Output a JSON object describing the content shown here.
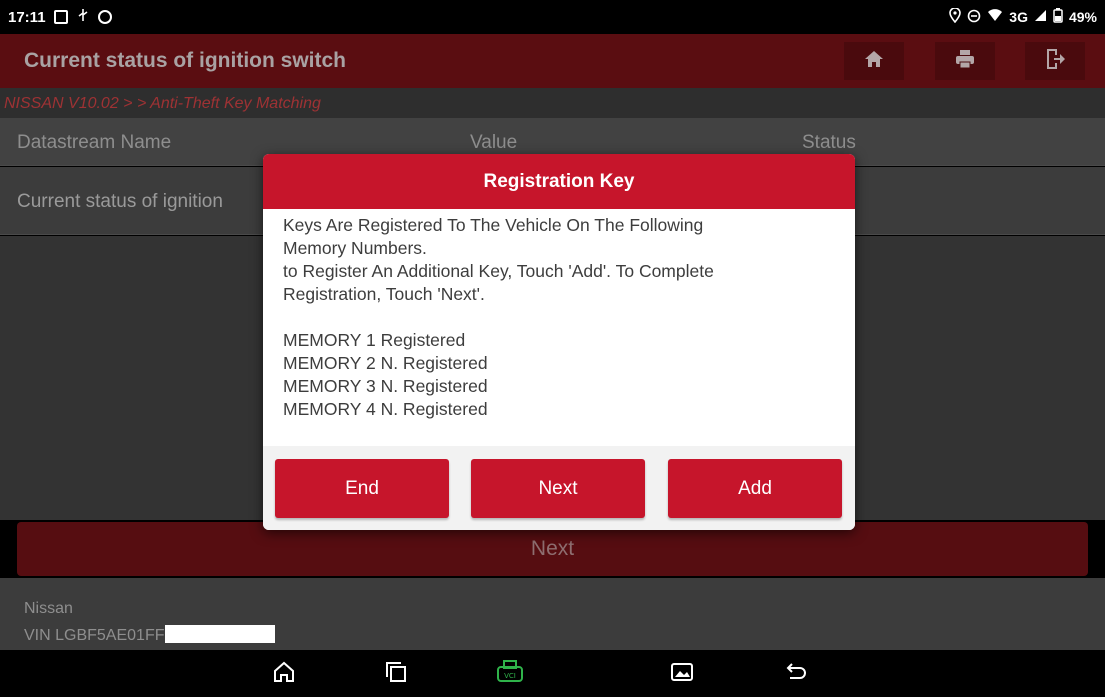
{
  "status_bar": {
    "time": "17:11",
    "network": "3G",
    "battery": "49%"
  },
  "header": {
    "title": "Current status of ignition switch",
    "icons": [
      "home-icon",
      "print-icon",
      "exit-icon"
    ]
  },
  "breadcrumb": "NISSAN V10.02 > > Anti-Theft Key Matching",
  "table": {
    "columns": [
      "Datastream Name",
      "Value",
      "Status"
    ],
    "rows": [
      {
        "name": "Current status of ignition"
      }
    ]
  },
  "next_label": "Next",
  "footer": {
    "make": "Nissan",
    "vin": "VIN LGBF5AE01FF"
  },
  "dialog": {
    "title": "Registration Key",
    "lines": [
      "Keys Are Registered To The Vehicle On The  Following",
      "Memory Numbers.",
      "to Register An Additional Key, Touch 'Add'. To Complete",
      "Registration, Touch 'Next'."
    ],
    "memory": [
      "MEMORY 1 Registered",
      "MEMORY 2 N. Registered",
      "MEMORY 3 N. Registered",
      "MEMORY 4 N. Registered"
    ],
    "buttons": {
      "end": "End",
      "next": "Next",
      "add": "Add"
    }
  },
  "nav_bar": {
    "vci_label": "VCI"
  },
  "colors": {
    "accent": "#c6152b",
    "header_bg": "#5a0d11",
    "breadcrumb_text": "#9e3234",
    "vci_green": "#2fb34a"
  }
}
